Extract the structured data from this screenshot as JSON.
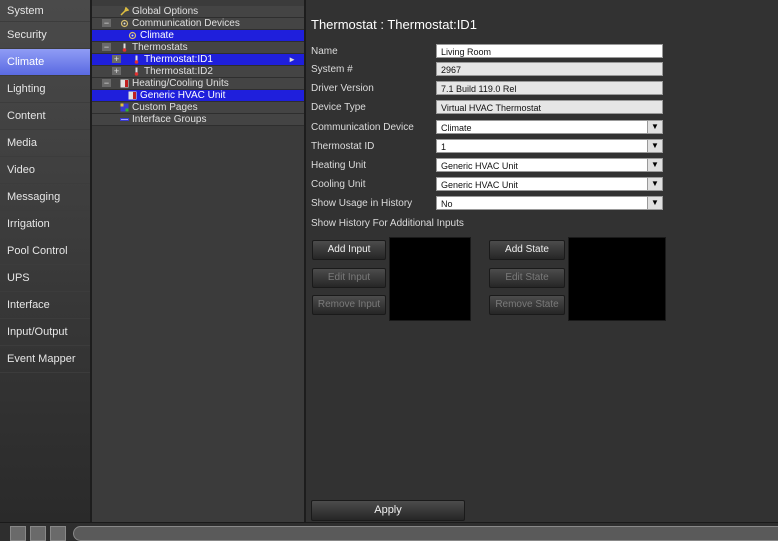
{
  "nav": {
    "items": [
      {
        "label": "System",
        "active": false
      },
      {
        "label": "Security",
        "active": false
      },
      {
        "label": "Climate",
        "active": true
      },
      {
        "label": "Lighting",
        "active": false
      },
      {
        "label": "Content",
        "active": false
      },
      {
        "label": "Media",
        "active": false
      },
      {
        "label": "Video",
        "active": false
      },
      {
        "label": "Messaging",
        "active": false
      },
      {
        "label": "Irrigation",
        "active": false
      },
      {
        "label": "Pool Control",
        "active": false
      },
      {
        "label": "UPS",
        "active": false
      },
      {
        "label": "Interface",
        "active": false
      },
      {
        "label": "Input/Output",
        "active": false
      },
      {
        "label": "Event Mapper",
        "active": false
      }
    ]
  },
  "tree": {
    "global_options": "Global Options",
    "communication_devices": "Communication Devices",
    "climate": "Climate",
    "thermostats": "Thermostats",
    "thermostat_id1": "Thermostat:ID1",
    "thermostat_id2": "Thermostat:ID2",
    "heating_cooling_units": "Heating/Cooling Units",
    "generic_hvac_unit": "Generic HVAC Unit",
    "custom_pages": "Custom Pages",
    "interface_groups": "Interface Groups"
  },
  "form": {
    "title": "Thermostat : Thermostat:ID1",
    "name_label": "Name",
    "name_value": "Living Room",
    "system_label": "System #",
    "system_value": "2967",
    "driver_label": "Driver Version",
    "driver_value": "7.1 Build 119.0 Rel",
    "device_type_label": "Device Type",
    "device_type_value": "Virtual HVAC Thermostat",
    "comm_device_label": "Communication Device",
    "comm_device_value": "Climate",
    "thermostat_id_label": "Thermostat ID",
    "thermostat_id_value": "1",
    "heating_unit_label": "Heating Unit",
    "heating_unit_value": "Generic HVAC Unit",
    "cooling_unit_label": "Cooling Unit",
    "cooling_unit_value": "Generic HVAC Unit",
    "usage_history_label": "Show Usage in History",
    "usage_history_value": "No",
    "additional_inputs_label": "Show History For Additional Inputs"
  },
  "buttons": {
    "add_input": "Add Input",
    "edit_input": "Edit Input",
    "remove_input": "Remove Input",
    "add_state": "Add State",
    "edit_state": "Edit State",
    "remove_state": "Remove State",
    "apply": "Apply"
  },
  "colors": {
    "nav_active": "#6b79ea",
    "tree_selected": "#1f1fdc",
    "background": "#323232"
  }
}
